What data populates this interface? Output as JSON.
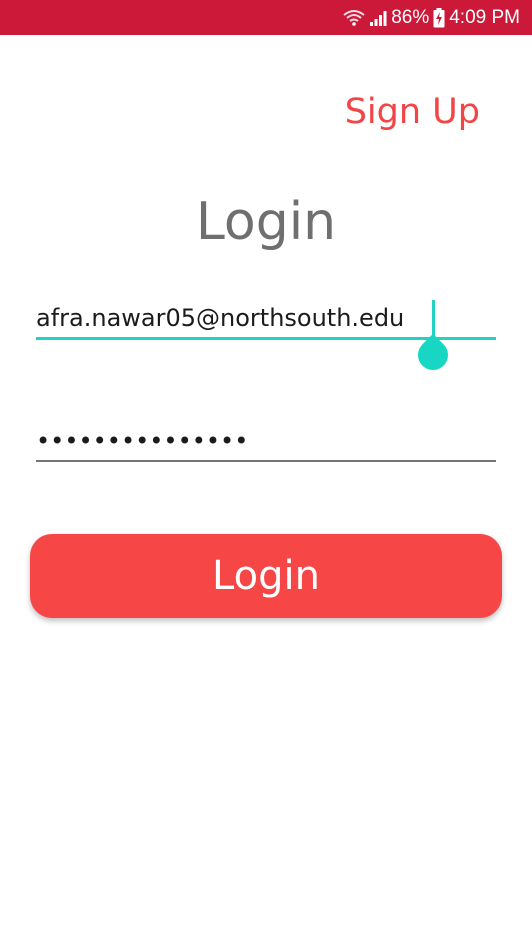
{
  "status_bar": {
    "battery_percent": "86%",
    "time": "4:09 PM",
    "icons": [
      "wifi-icon",
      "signal-icon",
      "battery-charging-icon"
    ]
  },
  "header": {
    "signup_label": "Sign Up"
  },
  "title": "Login",
  "form": {
    "email_value": "afra.nawar05@northsouth.edu",
    "password_masked": "•••••••••••••••",
    "login_label": "Login"
  },
  "colors": {
    "status_bar": "#cc1839",
    "accent_red": "#f74646",
    "focus_teal": "#22d3c1",
    "title_gray": "#6f6f6f"
  }
}
